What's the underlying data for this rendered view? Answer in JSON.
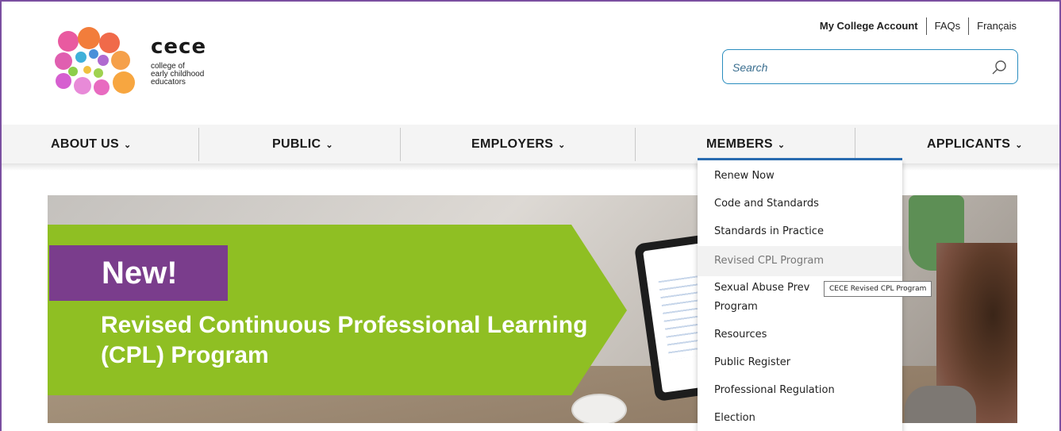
{
  "colors": {
    "accent": "#2a8dbf",
    "nav_active": "#2a6fb5",
    "banner_green": "#8fbf23",
    "banner_purple": "#7a3d8c",
    "frame": "#7b4fa0"
  },
  "logo": {
    "word": "cece",
    "subtitle_lines": [
      "college of",
      "early childhood",
      "educators"
    ]
  },
  "utility": {
    "account": "My College Account",
    "faqs": "FAQs",
    "language": "Français"
  },
  "search": {
    "placeholder": "Search",
    "icon": "search-icon"
  },
  "nav": {
    "items": [
      {
        "label": "ABOUT US"
      },
      {
        "label": "PUBLIC"
      },
      {
        "label": "EMPLOYERS"
      },
      {
        "label": "MEMBERS"
      },
      {
        "label": "APPLICANTS"
      }
    ],
    "active": "MEMBERS"
  },
  "banner": {
    "tag": "New!",
    "headline": "Revised Continuous Professional Learning (CPL) Program"
  },
  "dropdown": {
    "items": [
      "Renew Now",
      "Code and Standards",
      "Standards in Practice",
      "Revised CPL Program",
      "Sexual Abuse Prevention Program",
      "Resources",
      "Public Register",
      "Professional Regulation",
      "Election"
    ],
    "item4_line1": "Sexual Abuse Prev",
    "item4_line2": "Program",
    "hovered": "Revised CPL Program",
    "tooltip": "CECE Revised CPL Program"
  }
}
